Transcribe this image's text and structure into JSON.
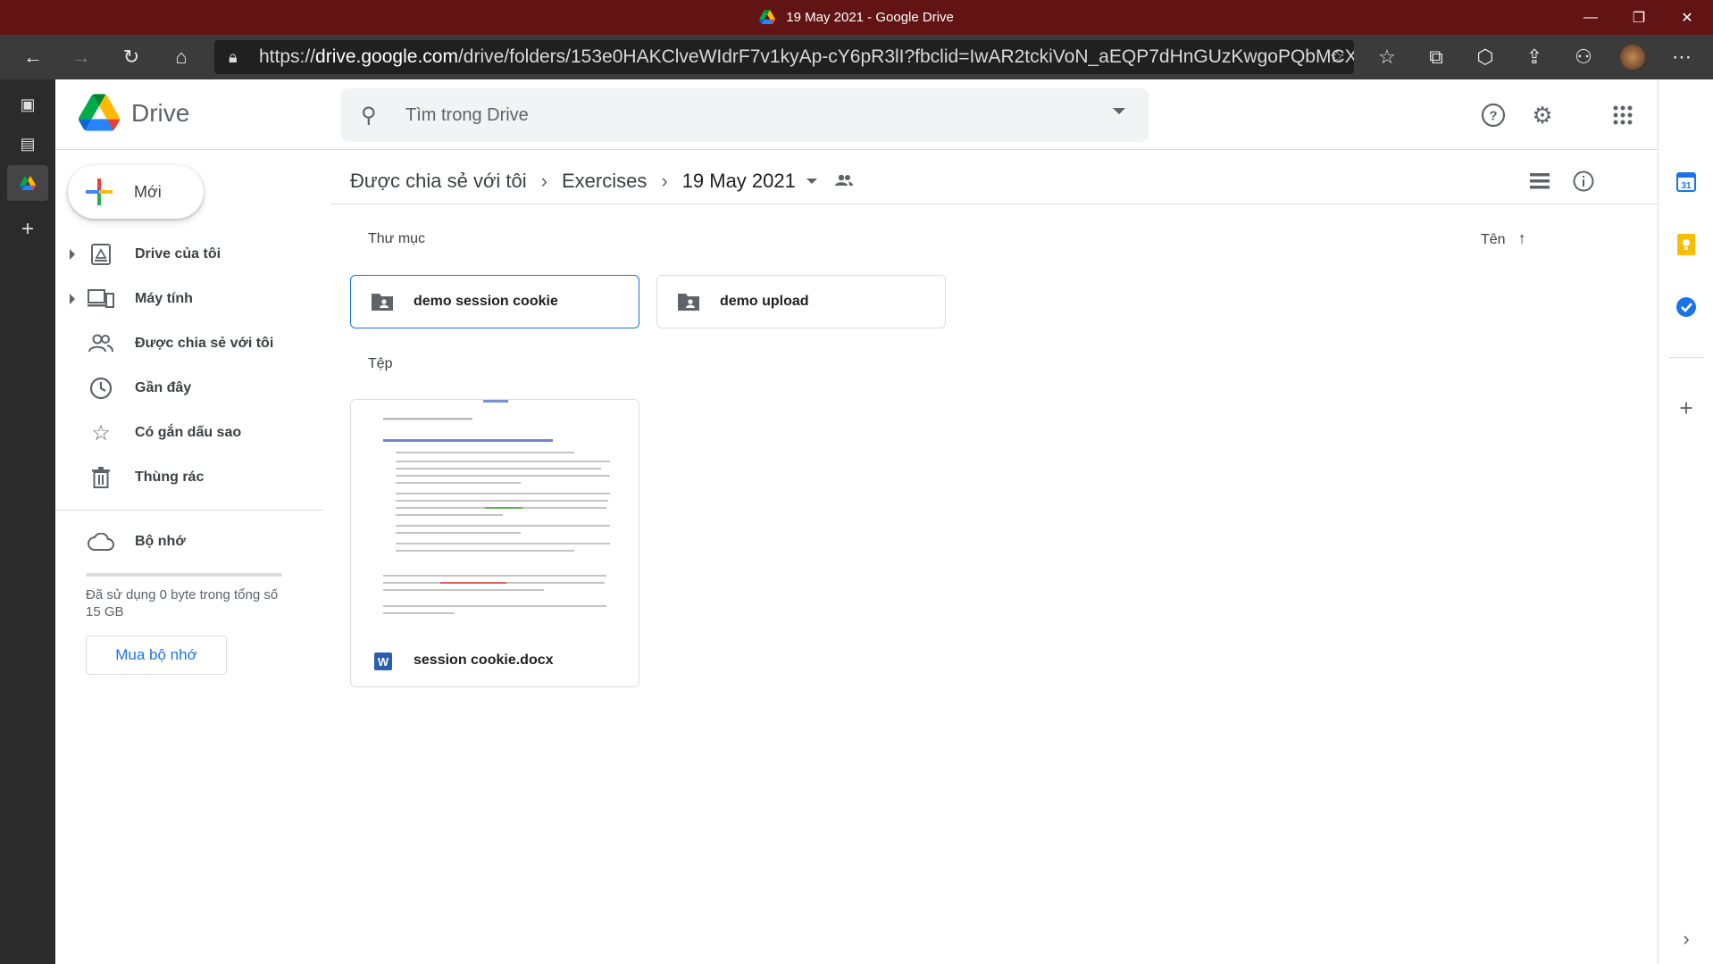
{
  "window": {
    "title": "19 May 2021 - Google Drive"
  },
  "browser": {
    "url_prefix": "https://",
    "url_host": "drive.google.com",
    "url_path": "/drive/folders/153e0HAKClveWIdrF7v1kyAp-cY6pR3lI?fbclid=IwAR2tckiVoN_aEQP7dHnGUzKwgoPQbMCX..."
  },
  "app": {
    "name": "Drive"
  },
  "search": {
    "placeholder": "Tìm trong Drive"
  },
  "nav": {
    "new_label": "Mới",
    "items": [
      {
        "label": "Drive của tôi",
        "icon": "my-drive-icon"
      },
      {
        "label": "Máy tính",
        "icon": "computers-icon"
      },
      {
        "label": "Được chia sẻ với tôi",
        "icon": "shared-icon"
      },
      {
        "label": "Gần đây",
        "icon": "clock-icon"
      },
      {
        "label": "Có gắn dấu sao",
        "icon": "star-icon"
      },
      {
        "label": "Thùng rác",
        "icon": "trash-icon"
      }
    ],
    "storage_label": "Bộ nhớ",
    "storage_used": 0,
    "storage_text": "Đã sử dụng 0 byte trong tổng số 15 GB",
    "buy_label": "Mua bộ nhớ"
  },
  "breadcrumb": [
    "Được chia sẻ với tôi",
    "Exercises",
    "19 May 2021"
  ],
  "sections": {
    "folders_label": "Thư mục",
    "files_label": "Tệp",
    "sort_label": "Tên"
  },
  "folders": [
    {
      "name": "demo session cookie",
      "selected": true
    },
    {
      "name": "demo upload",
      "selected": false
    }
  ],
  "files": [
    {
      "name": "session cookie.docx",
      "type": "docx",
      "type_badge": "W"
    }
  ],
  "colors": {
    "titlebar": "#621414",
    "accent": "#1a73e8",
    "toolbar": "#3b3b3b"
  }
}
